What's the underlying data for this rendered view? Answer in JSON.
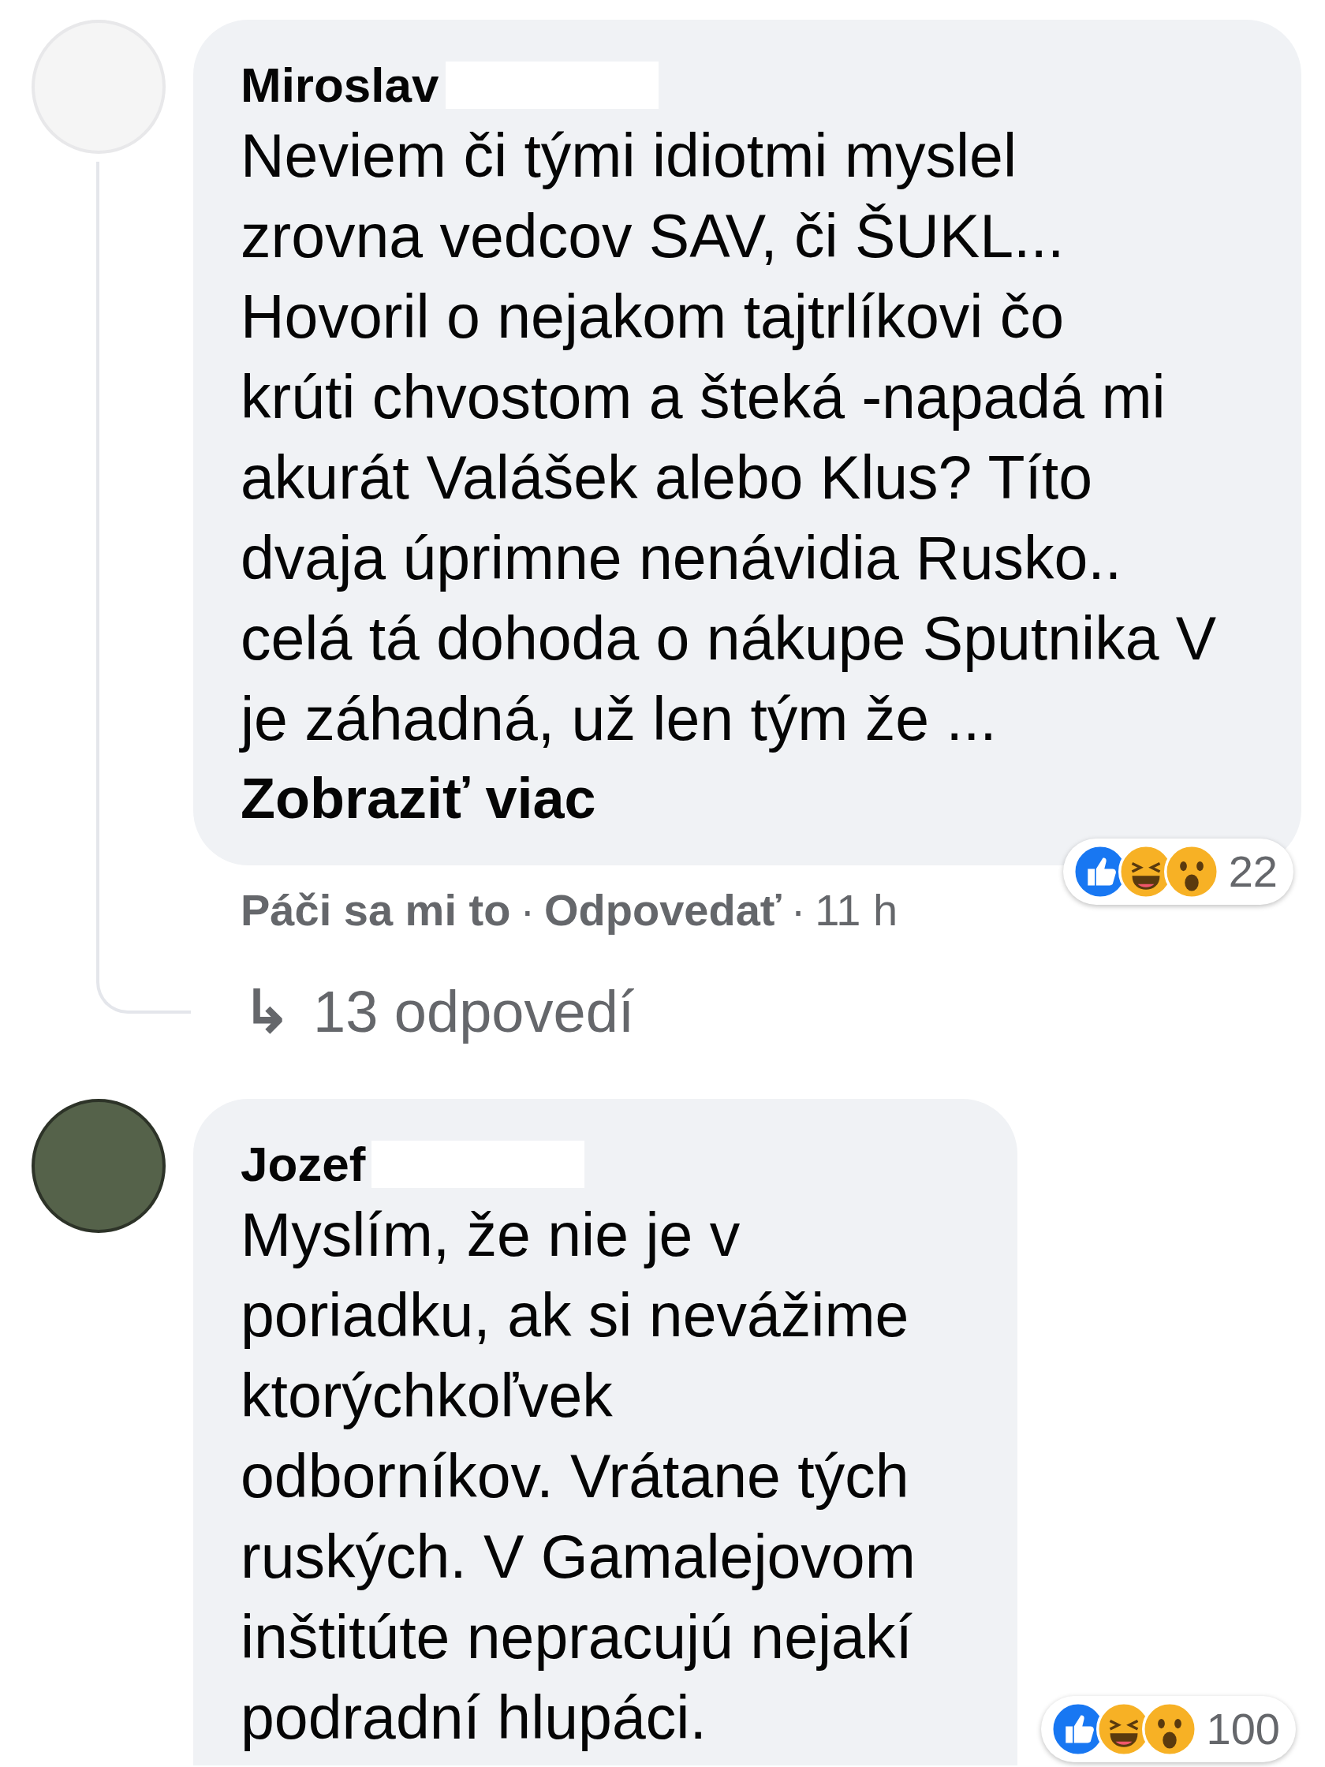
{
  "comments": [
    {
      "author": "Miroslav",
      "redacted_surname": true,
      "lines": [
        "Neviem či tými idiotmi myslel",
        "zrovna vedcov SAV, či ŠUKL...",
        "Hovoril o nejakom tajtrlíkovi čo",
        "krúti chvostom a šteká -napadá mi",
        "akurát Valášek alebo Klus? Títo",
        "dvaja úprimne nenávidia Rusko..",
        "celá tá dohoda o nákupe Sputnika V",
        "je záhadná, už len tým že ..."
      ],
      "see_more": "Zobraziť viac",
      "reaction_count": "22",
      "actions": {
        "like": "Páči sa mi to",
        "separator_1": "·",
        "reply": "Odpovedať",
        "separator_2": "·",
        "time": "11 h"
      },
      "replies_link": {
        "icon": "↳",
        "label": "13 odpovedí"
      }
    },
    {
      "author": "Jozef",
      "redacted_surname": true,
      "lines": [
        "Myslím, že nie je v",
        "poriadku, ak si nevážime",
        "ktorýchkoľvek",
        "odborníkov. Vrátane tých",
        "ruských. V Gamalejovom",
        "inštitúte nepracujú nejakí",
        "podradní hlupáci."
      ],
      "reaction_count": "100"
    }
  ]
}
